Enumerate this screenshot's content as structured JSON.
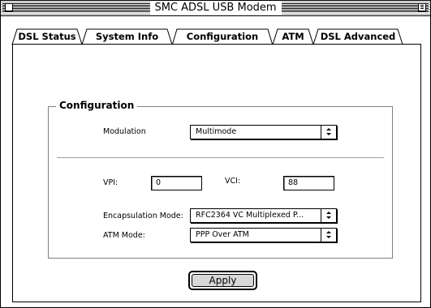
{
  "window": {
    "title": "SMC ADSL USB Modem"
  },
  "tabs": [
    {
      "label": "DSL Status",
      "active": false
    },
    {
      "label": "System Info",
      "active": false
    },
    {
      "label": "Configuration",
      "active": true
    },
    {
      "label": "ATM",
      "active": false
    },
    {
      "label": "DSL Advanced",
      "active": false
    }
  ],
  "config": {
    "group_title": "Configuration",
    "modulation": {
      "label": "Modulation",
      "value": "Multimode"
    },
    "vpi": {
      "label": "VPI:",
      "value": "0"
    },
    "vci": {
      "label": "VCI:",
      "value": "88"
    },
    "encapsulation": {
      "label": "Encapsulation Mode:",
      "value": "RFC2364 VC Multiplexed P..."
    },
    "atm_mode": {
      "label": "ATM Mode:",
      "value": "PPP Over ATM"
    }
  },
  "buttons": {
    "apply": "Apply"
  }
}
